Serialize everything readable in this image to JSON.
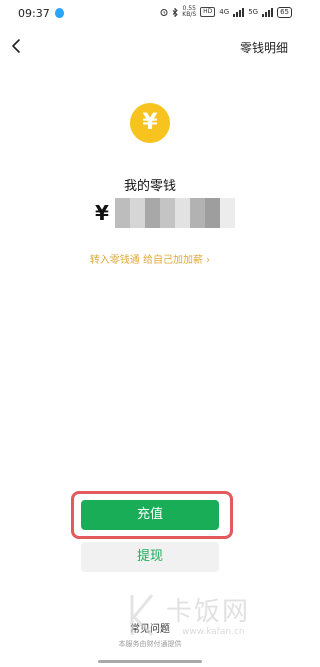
{
  "status_bar": {
    "time": "09:37",
    "net_speed_value": "0.55",
    "net_speed_unit": "KB/S",
    "hd_badge": "HD",
    "network_a": "4G",
    "network_b": "5G",
    "battery": "65"
  },
  "nav": {
    "right_label": "零钱明细"
  },
  "wallet": {
    "coin_symbol": "¥",
    "label": "我的零钱",
    "currency_symbol": "¥",
    "promo_text": "转入零钱通 给自己加加薪 ›"
  },
  "actions": {
    "recharge_label": "充值",
    "withdraw_label": "提现"
  },
  "footer": {
    "faq_label": "常见问题",
    "note": "本服务由财付通提供"
  },
  "watermark": {
    "brand": "卡饭网",
    "url": "www.kafan.cn"
  },
  "colors": {
    "accent_green": "#1aad57",
    "coin_yellow": "#f7c31e",
    "promo_orange": "#e1a93a",
    "highlight_red": "#e4595d"
  }
}
